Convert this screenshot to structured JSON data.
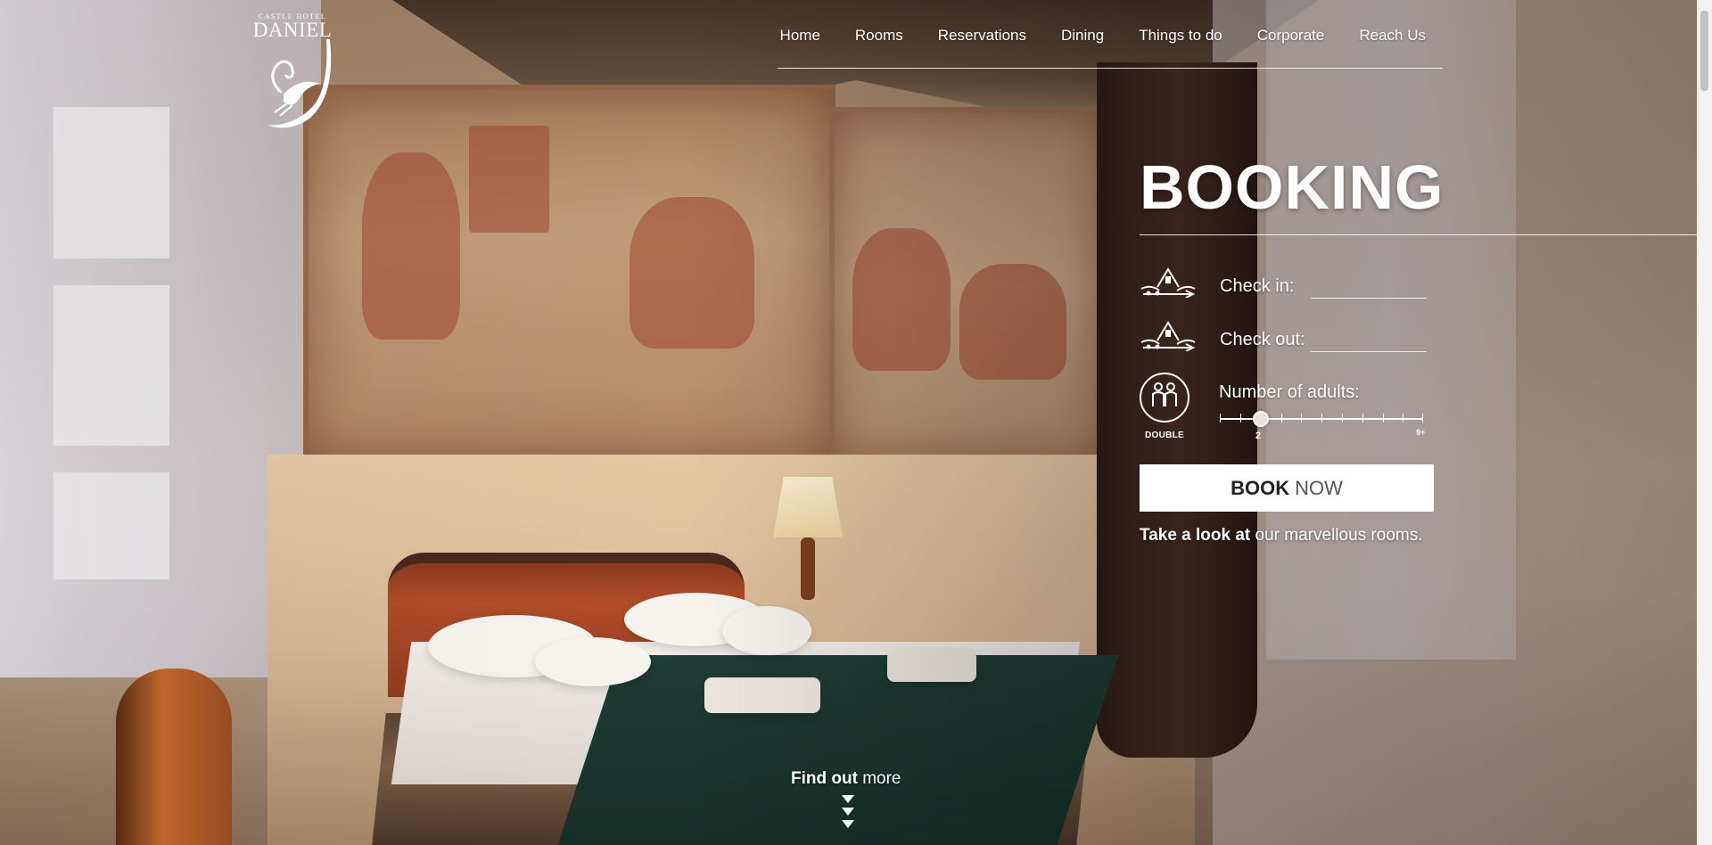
{
  "logo": {
    "small": "CASTLE HOTEL",
    "name": "DANIEL"
  },
  "nav": {
    "items": [
      "Home",
      "Rooms",
      "Reservations",
      "Dining",
      "Things to do",
      "Corporate",
      "Reach Us"
    ]
  },
  "booking": {
    "title": "BOOKING",
    "checkin_label": "Check in:",
    "checkin_value": "",
    "checkout_label": "Check out:",
    "checkout_value": "",
    "adults_label": "Number of adults:",
    "adults_icon_caption": "DOUBLE",
    "adults_value": "2",
    "adults_max": "9+",
    "book_bold": "BOOK",
    "book_light": "NOW"
  },
  "lookat": {
    "bold": "Take a look at",
    "rest": "our marvellous rooms."
  },
  "findout": {
    "bold": "Find out",
    "rest": "more"
  },
  "icons": {
    "checkin": "house-arrow-in-icon",
    "checkout": "house-arrow-out-icon",
    "adults": "two-people-icon",
    "logo": "swan-crest-icon"
  },
  "colors": {
    "button_bg": "#ffffff",
    "button_text": "#222222",
    "text": "#ffffff"
  }
}
